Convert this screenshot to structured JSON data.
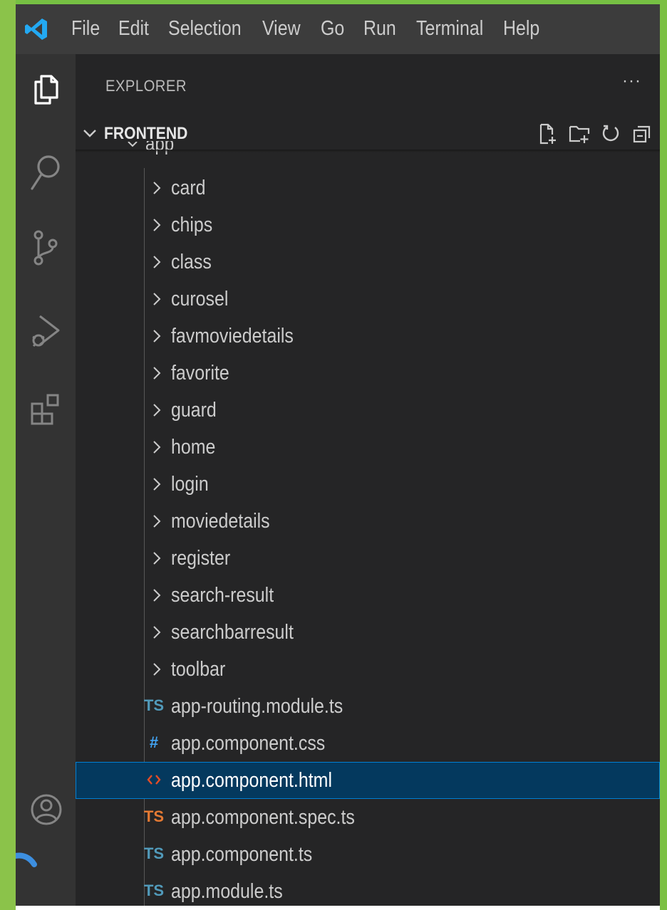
{
  "menubar": {
    "items": [
      "File",
      "Edit",
      "Selection",
      "View",
      "Go",
      "Run",
      "Terminal",
      "Help"
    ]
  },
  "activity_icons": [
    "files-icon",
    "search-icon",
    "source-control-icon",
    "run-debug-icon",
    "extensions-icon",
    "account-icon"
  ],
  "explorer": {
    "title": "EXPLORER",
    "more": "···",
    "section": "FRONTEND",
    "parent_folder": "app",
    "folders": [
      "card",
      "chips",
      "class",
      "curosel",
      "favmoviedetails",
      "favorite",
      "guard",
      "home",
      "login",
      "moviedetails",
      "register",
      "search-result",
      "searchbarresult",
      "toolbar"
    ],
    "files": [
      {
        "name": "app-routing.module.ts",
        "icon": "TS",
        "kind": "ts"
      },
      {
        "name": "app.component.css",
        "icon": "#",
        "kind": "css"
      },
      {
        "name": "app.component.html",
        "icon": "<>",
        "kind": "html"
      },
      {
        "name": "app.component.spec.ts",
        "icon": "TS",
        "kind": "spec"
      },
      {
        "name": "app.component.ts",
        "icon": "TS",
        "kind": "ts"
      },
      {
        "name": "app.module.ts",
        "icon": "TS",
        "kind": "ts"
      }
    ],
    "selected_file": "app.component.html"
  },
  "colors": {
    "frame_green": "#7bc043",
    "sidebar_bg": "#252526",
    "activity_bg": "#333333",
    "menubar_bg": "#3c3c3c",
    "selection_bg": "#04395e",
    "selection_border": "#007fd4",
    "ts_blue": "#519aba",
    "ts_orange": "#e37933",
    "css_blue": "#42a5f5",
    "html_red": "#e44d26"
  }
}
